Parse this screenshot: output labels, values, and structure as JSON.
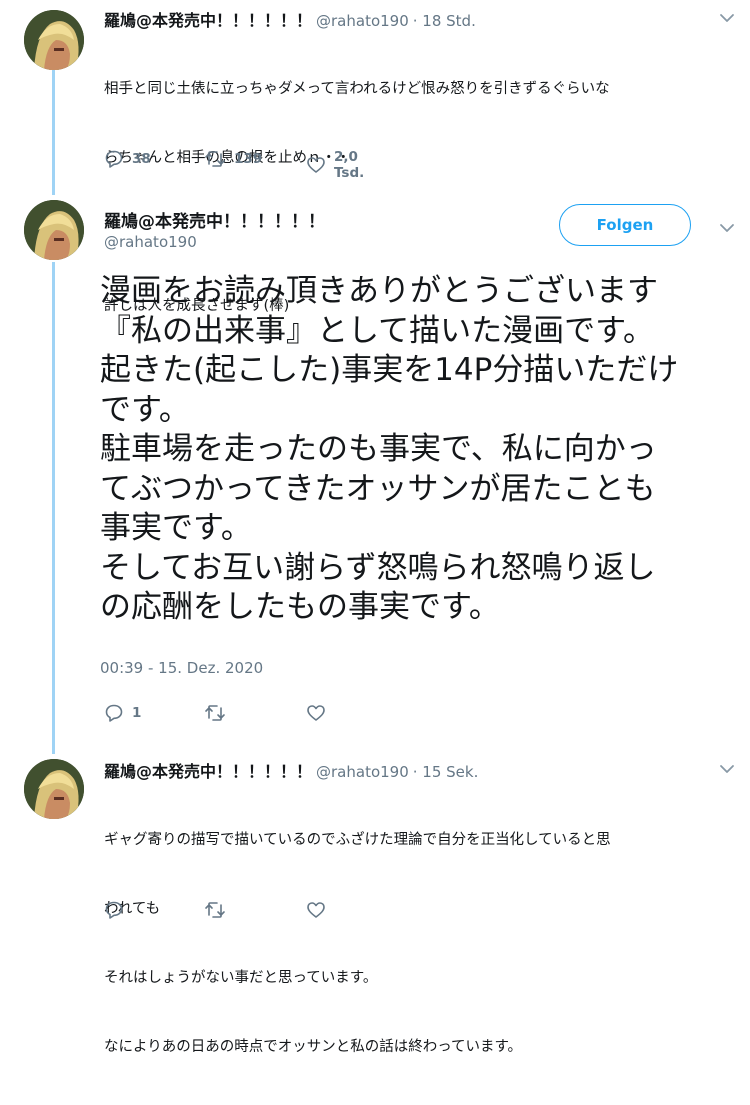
{
  "tweets": [
    {
      "display_name": "羅鳩@本発売中！！！！！！",
      "handle": "@rahato190",
      "time": "· 18 Std.",
      "lines": [
        "相手と同じ土俵に立っちゃダメって言われるけど恨み怒りを引きずるぐらいな",
        "らちゃんと相手の息の根を止めｎ・・",
        "",
        "許しは人を成長させます(棒)"
      ],
      "reply_count": "38",
      "retweet_count": "139",
      "like_count": "2,0 Tsd."
    },
    {
      "display_name": "羅鳩@本発売中！！！！！！",
      "handle": "@rahato190",
      "follow_label": "Folgen",
      "lines": [
        "漫画をお読み頂きありがとうございます",
        "『私の出来事』として描いた漫画です。",
        "起きた(起こした)事実を14P分描いただけ",
        "です。",
        "駐車場を走ったのも事実で、私に向かっ",
        "てぶつかってきたオッサンが居たことも",
        "事実です。",
        "そしてお互い謝らず怒鳴られ怒鳴り返し",
        "の応酬をしたもの事実です。"
      ],
      "timestamp": "00:39 - 15. Dez. 2020",
      "reply_count": "1",
      "retweet_count": "",
      "like_count": ""
    },
    {
      "display_name": "羅鳩@本発売中！！！！！！",
      "handle": "@rahato190",
      "time": "· 15 Sek.",
      "lines": [
        "ギャグ寄りの描写で描いているのでふざけた理論で自分を正当化していると思",
        "われても",
        "それはしょうがない事だと思っています。",
        "なによりあの日あの時点でオッサンと私の話は終わっています。"
      ],
      "reply_count": "",
      "retweet_count": "",
      "like_count": ""
    }
  ],
  "icons": {
    "reply": "reply-icon",
    "retweet": "retweet-icon",
    "like": "heart-icon",
    "more": "chevron-down-icon"
  },
  "colors": {
    "accent": "#1da1f2",
    "thread_line": "#9fd3f5",
    "secondary_text": "#657786",
    "text": "#14171a"
  }
}
